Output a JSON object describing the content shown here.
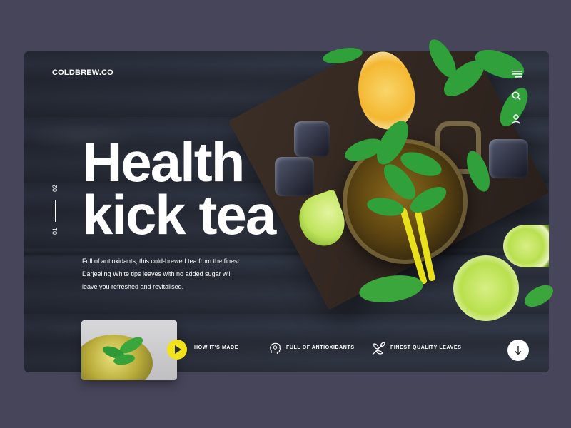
{
  "brand": {
    "logo": "COLDBREW.CO"
  },
  "nav": {
    "icons": [
      "menu-icon",
      "search-icon",
      "user-icon"
    ]
  },
  "hero": {
    "headline_line1": "Health",
    "headline_line2": "kick tea",
    "description": "Full of antioxidants, this cold-brewed tea from the finest Darjeeling White tips leaves with no added sugar will leave you refreshed and revitalised."
  },
  "pager": {
    "current": "01",
    "next": "02"
  },
  "features": [
    {
      "label": "HOW IT'S MADE",
      "icon": "play-icon"
    },
    {
      "label": "FULL OF ANTIOXIDANTS",
      "icon": "head-icon"
    },
    {
      "label": "FINEST QUALITY LEAVES",
      "icon": "leaf-icon"
    }
  ],
  "colors": {
    "page_bg": "#474559",
    "accent": "#f2e21a",
    "text": "#ffffff"
  }
}
